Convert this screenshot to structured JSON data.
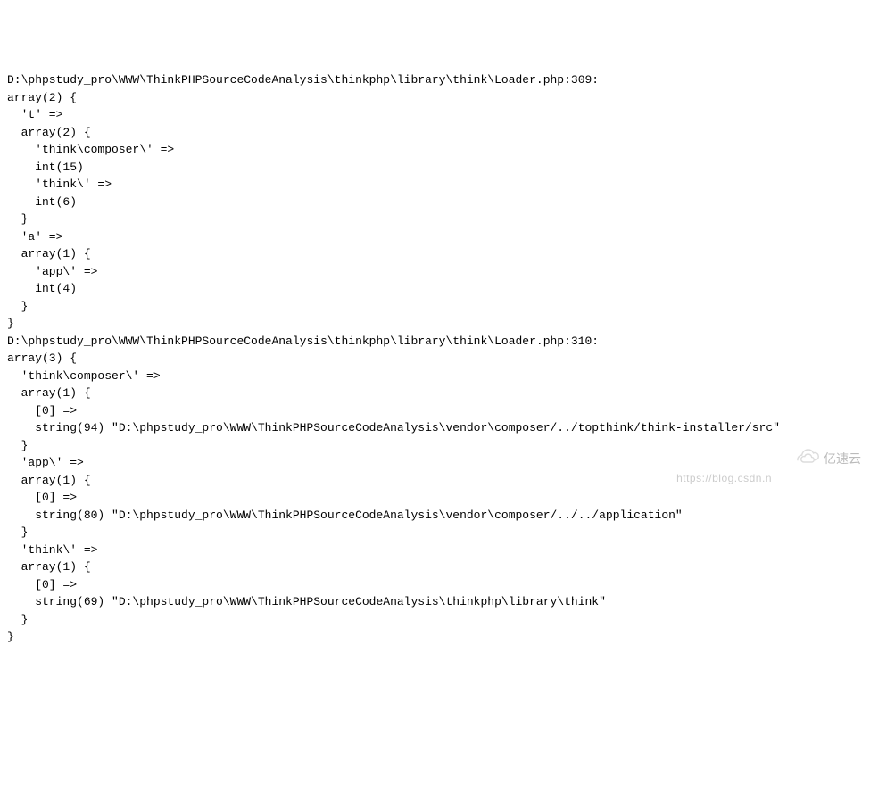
{
  "dump1": {
    "header": "D:\\phpstudy_pro\\WWW\\ThinkPHPSourceCodeAnalysis\\thinkphp\\library\\think\\Loader.php:309:",
    "line1": "array(2) {",
    "line2": "  't' =>",
    "line3": "  array(2) {",
    "line4": "    'think\\composer\\' =>",
    "line5": "    int(15)",
    "line6": "    'think\\' =>",
    "line7": "    int(6)",
    "line8": "  }",
    "line9": "  'a' =>",
    "line10": "  array(1) {",
    "line11": "    'app\\' =>",
    "line12": "    int(4)",
    "line13": "  }",
    "line14": "}"
  },
  "dump2": {
    "header": "D:\\phpstudy_pro\\WWW\\ThinkPHPSourceCodeAnalysis\\thinkphp\\library\\think\\Loader.php:310:",
    "line1": "array(3) {",
    "line2": "  'think\\composer\\' =>",
    "line3": "  array(1) {",
    "line4": "    [0] =>",
    "line5": "    string(94) \"D:\\phpstudy_pro\\WWW\\ThinkPHPSourceCodeAnalysis\\vendor\\composer/../topthink/think-installer/src\"",
    "line6": "  }",
    "line7": "  'app\\' =>",
    "line8": "  array(1) {",
    "line9": "    [0] =>",
    "line10": "    string(80) \"D:\\phpstudy_pro\\WWW\\ThinkPHPSourceCodeAnalysis\\vendor\\composer/../../application\"",
    "line11": "  }",
    "line12": "  'think\\' =>",
    "line13": "  array(1) {",
    "line14": "    [0] =>",
    "line15": "    string(69) \"D:\\phpstudy_pro\\WWW\\ThinkPHPSourceCodeAnalysis\\thinkphp\\library\\think\"",
    "line16": "  }",
    "line17": "}"
  },
  "watermark": {
    "blog_url": "https://blog.csdn.n",
    "brand": "亿速云"
  }
}
